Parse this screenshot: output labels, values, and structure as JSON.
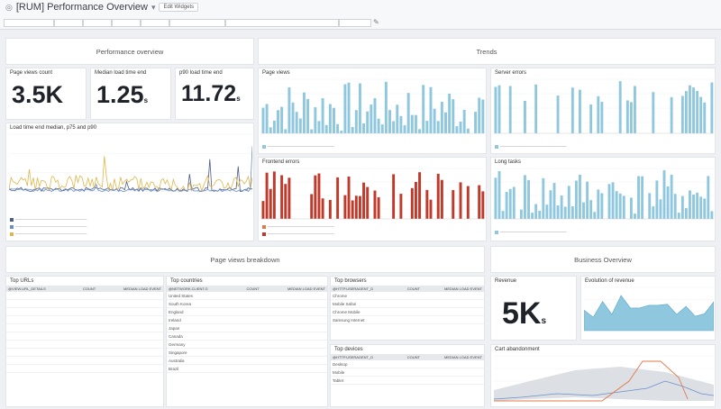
{
  "header": {
    "title": "[RUM] Performance Overview",
    "widgets_button": "Edit Widgets"
  },
  "sections": {
    "performance_overview": "Performance overview",
    "trends": "Trends",
    "page_views_breakdown": "Page views breakdown",
    "business_overview": "Business Overview"
  },
  "metrics": {
    "page_views": {
      "label": "Page views count",
      "value": "3.5K"
    },
    "median_load": {
      "label": "Median load time end",
      "value": "1.25",
      "unit": "s"
    },
    "p90_load": {
      "label": "p90 load time end",
      "value": "11.72",
      "unit": "s"
    },
    "revenue": {
      "label": "Revenue",
      "value": "5K",
      "unit": "s"
    }
  },
  "widgets": {
    "load_time": "Load time end median, p75 and p90",
    "page_views_trend": "Page views",
    "server_errors": "Server errors",
    "frontend_errors": "Frontend errors",
    "long_tasks": "Long tasks",
    "evolution_revenue": "Evolution of revenue",
    "cart_abandonment": "Cart abandonment",
    "top_devices": "Top devices"
  },
  "colors": {
    "blue": "#8ec7de",
    "red": "#c0392b",
    "yellow": "#e0b64a",
    "navy": "#4b5d8a",
    "orange": "#e07a4a"
  },
  "tables": {
    "top_urls": {
      "title": "Top URLs",
      "columns": [
        "@VIEW.URL_DETAILS",
        "COUNT",
        "MEDIAN LOAD EVENT"
      ]
    },
    "top_countries": {
      "title": "Top countries",
      "columns": [
        "@NETWORK.CLIENT.G",
        "COUNT",
        "MEDIAN LOAD EVENT"
      ],
      "rows": [
        [
          "United States",
          "",
          ""
        ],
        [
          "South Korea",
          "",
          ""
        ],
        [
          "England",
          "",
          ""
        ],
        [
          "Ireland",
          "",
          ""
        ],
        [
          "Japan",
          "",
          ""
        ],
        [
          "Canada",
          "",
          ""
        ],
        [
          "Germany",
          "",
          ""
        ],
        [
          "Singapore",
          "",
          ""
        ],
        [
          "Australia",
          "",
          ""
        ],
        [
          "Brazil",
          "",
          ""
        ]
      ]
    },
    "top_browsers": {
      "title": "Top browsers",
      "columns": [
        "@HTTP.USERAGENT_D",
        "COUNT",
        "MEDIAN LOAD EVENT"
      ],
      "rows": [
        [
          "Chrome",
          "",
          ""
        ],
        [
          "Mobile Safari",
          "",
          ""
        ],
        [
          "Chrome Mobile",
          "",
          ""
        ],
        [
          "Samsung Internet",
          "",
          ""
        ]
      ]
    },
    "top_devices": {
      "title": "Top devices",
      "columns": [
        "@HTTP.USERAGENT_D",
        "COUNT",
        "MEDIAN LOAD EVENT"
      ],
      "rows": [
        [
          "Desktop",
          "",
          ""
        ],
        [
          "Mobile",
          "",
          ""
        ],
        [
          "Tablet",
          "",
          ""
        ]
      ]
    }
  }
}
